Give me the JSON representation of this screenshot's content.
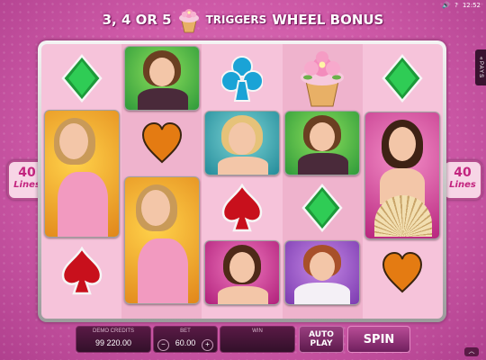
{
  "system": {
    "clock": "12:52",
    "speaker_icon": "speaker-icon",
    "help_icon": "help-icon"
  },
  "banner": {
    "part1": "3, 4 OR 5",
    "part2": "TRIGGERS",
    "part3": "WHEEL BONUS"
  },
  "lines": {
    "left_count": "40",
    "left_word": "Lines",
    "right_count": "40",
    "right_word": "Lines"
  },
  "paytable_tab": {
    "label": "PAYS",
    "icon": "double-chevron-left-icon"
  },
  "reels": [
    [
      "green-diamond",
      "woman-blonde-orange",
      "red-spade"
    ],
    [
      "woman-brunette-green",
      "orange-heart",
      "woman-blonde-orange"
    ],
    [
      "blue-club",
      "woman-blonde-teal",
      "red-spade",
      "woman-dark-pink"
    ],
    [
      "cupcake",
      "woman-brunette-green",
      "green-diamond",
      "woman-redhead-purple"
    ],
    [
      "green-diamond",
      "woman-dark-fan-pink",
      "orange-heart"
    ]
  ],
  "controls": {
    "credits_label": "DEMO CREDITS",
    "credits_value": "99 220.00",
    "bet_label": "BET",
    "bet_value": "60.00",
    "bet_minus": "−",
    "bet_plus": "+",
    "win_label": "WIN",
    "win_value": "",
    "autoplay_label": "AUTO PLAY",
    "spin_label": "SPIN"
  },
  "colors": {
    "accent": "#c3247f",
    "bg": "#cf5aa8",
    "panel": "#3d1234"
  }
}
